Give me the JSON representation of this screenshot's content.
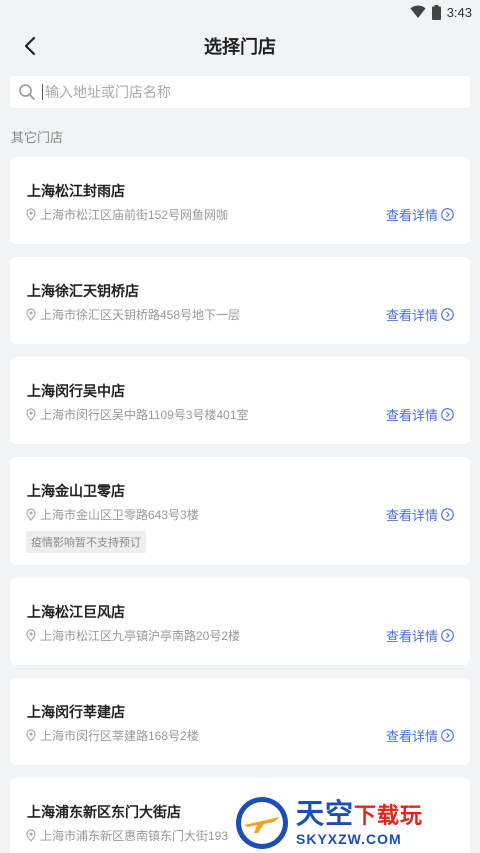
{
  "status": {
    "time": "3:43"
  },
  "header": {
    "title": "选择门店"
  },
  "search": {
    "placeholder": "输入地址或门店名称"
  },
  "section": {
    "label": "其它门店"
  },
  "stores": [
    {
      "name": "上海松江封雨店",
      "address": "上海市松江区庙前街152号网鱼网咖",
      "detail_label": "查看详情",
      "notice": ""
    },
    {
      "name": "上海徐汇天钥桥店",
      "address": "上海市徐汇区天钥桥路458号地下一层",
      "detail_label": "查看详情",
      "notice": ""
    },
    {
      "name": "上海闵行吴中店",
      "address": "上海市闵行区吴中路1109号3号楼401室",
      "detail_label": "查看详情",
      "notice": ""
    },
    {
      "name": "上海金山卫零店",
      "address": "上海市金山区卫零路643号3楼",
      "detail_label": "查看详情",
      "notice": "疫情影响暂不支持预订"
    },
    {
      "name": "上海松江巨风店",
      "address": "上海市松江区九亭镇沪亭南路20号2楼",
      "detail_label": "查看详情",
      "notice": ""
    },
    {
      "name": "上海闵行莘建店",
      "address": "上海市闵行区莘建路168号2楼",
      "detail_label": "查看详情",
      "notice": ""
    },
    {
      "name": "上海浦东新区东门大街店",
      "address": "上海市浦东新区惠南镇东门大街193",
      "detail_label": "",
      "notice": ""
    }
  ],
  "watermark": {
    "cn_main": "天空",
    "cn_accent": "下载玩",
    "en": "SKYXZW.COM"
  }
}
